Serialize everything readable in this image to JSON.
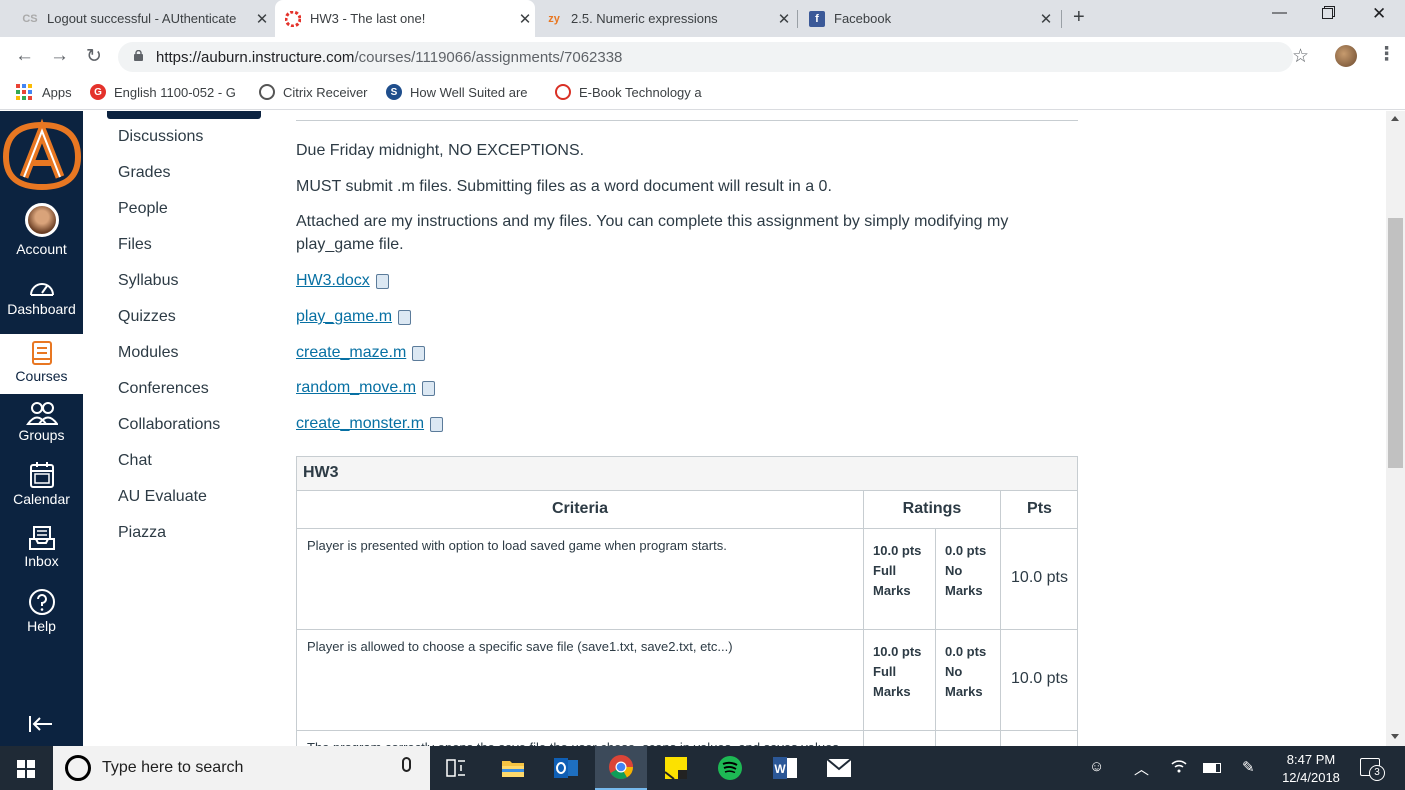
{
  "browser": {
    "tabs": [
      {
        "title": "Logout successful - AUthenticate",
        "favicon": "cas-icon"
      },
      {
        "title": "HW3 - The last one!",
        "favicon": "canvas-icon"
      },
      {
        "title": "2.5. Numeric expressions",
        "favicon": "zy-icon",
        "favicon_text": "zy"
      },
      {
        "title": "Facebook",
        "favicon": "facebook-icon",
        "favicon_text": "f"
      }
    ],
    "url_domain": "https://auburn.instructure.com",
    "url_path": "/courses/1119066/assignments/7062338",
    "bookmarks": [
      {
        "label": "Apps",
        "icon": "apps-grid-icon"
      },
      {
        "label": "English 1100-052 - G",
        "icon": "course-icon",
        "icon_text": "G"
      },
      {
        "label": "Citrix Receiver",
        "icon": "citrix-icon"
      },
      {
        "label": "How Well Suited are",
        "icon": "s-icon",
        "icon_text": "S"
      },
      {
        "label": "E-Book Technology a",
        "icon": "ebook-icon"
      }
    ]
  },
  "global_nav": {
    "items": [
      {
        "label": "Account",
        "icon": "avatar-icon"
      },
      {
        "label": "Dashboard",
        "icon": "dashboard-icon"
      },
      {
        "label": "Courses",
        "icon": "courses-icon"
      },
      {
        "label": "Groups",
        "icon": "groups-icon"
      },
      {
        "label": "Calendar",
        "icon": "calendar-icon"
      },
      {
        "label": "Inbox",
        "icon": "inbox-icon"
      },
      {
        "label": "Help",
        "icon": "help-icon"
      }
    ]
  },
  "course_nav": {
    "items": [
      "Discussions",
      "Grades",
      "People",
      "Files",
      "Syllabus",
      "Quizzes",
      "Modules",
      "Conferences",
      "Collaborations",
      "Chat",
      "AU Evaluate",
      "Piazza"
    ]
  },
  "assignment": {
    "paragraphs": [
      "Due Friday midnight, NO EXCEPTIONS.",
      "MUST submit .m files. Submitting files as a word document will result in a 0.",
      "Attached are my instructions and my files. You can complete this assignment by simply modifying my play_game file."
    ],
    "files": [
      "HW3.docx",
      "play_game.m",
      "create_maze.m",
      "random_move.m",
      "create_monster.m"
    ]
  },
  "rubric": {
    "title": "HW3",
    "headers": {
      "criteria": "Criteria",
      "ratings": "Ratings",
      "pts": "Pts"
    },
    "rows": [
      {
        "criterion": "Player is presented with option to load saved game when program starts.",
        "rating_full_pts": "10.0 pts",
        "rating_full_label_1": "Full",
        "rating_full_label_2": "Marks",
        "rating_none_pts": "0.0 pts",
        "rating_none_label_1": "No",
        "rating_none_label_2": "Marks",
        "pts": "10.0 pts"
      },
      {
        "criterion": "Player is allowed to choose a specific save file (save1.txt, save2.txt, etc...)",
        "rating_full_pts": "10.0 pts",
        "rating_full_label_1": "Full",
        "rating_full_label_2": "Marks",
        "rating_none_pts": "0.0 pts",
        "rating_none_label_1": "No",
        "rating_none_label_2": "Marks",
        "pts": "10.0 pts"
      },
      {
        "criterion": "The program correctly opens the save file the user chose, scans in values, and saves values"
      }
    ]
  },
  "taskbar": {
    "search_placeholder": "Type here to search",
    "time": "8:47 PM",
    "date": "12/4/2018",
    "notification_count": "3"
  },
  "colors": {
    "canvas_nav": "#0c2340",
    "auburn_orange": "#e87722",
    "link": "#0770a3"
  }
}
